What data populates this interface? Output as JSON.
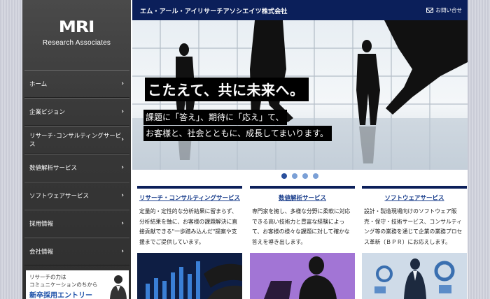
{
  "header": {
    "company_name": "エム・アール・アイリサーチアソシエイツ株式会社",
    "contact_label": "お問い合せ"
  },
  "logo": {
    "mark": "MRI",
    "subtitle": "Research Associates"
  },
  "sidebar": {
    "items": [
      {
        "label": "ホーム"
      },
      {
        "label": "企業ビジョン"
      },
      {
        "label": "リサーチ･コンサルティングサービス"
      },
      {
        "label": "数値解析サービス"
      },
      {
        "label": "ソフトウェアサービス"
      },
      {
        "label": "採用情報"
      },
      {
        "label": "会社情報"
      }
    ],
    "arrow": "›",
    "banner": {
      "line1": "リサーチの力は",
      "line2": "コミュニケーションのちから",
      "line3": "新卒採用エントリー"
    }
  },
  "hero": {
    "headline": "こたえて、共に未来へ。",
    "line1": "課題に「答え」、期待に「応え」て、",
    "line2": "お客様と、社会とともに、成長してまいります。",
    "slide_count": 4,
    "active_slide": 0
  },
  "services": [
    {
      "title": "リサーチ・コンサルティングサービス",
      "text": "定量的・定性的な分析結果に留まらず、分析結果を軸に、お客様の課題解決に直接貢献できる\"一歩踏み込んだ\"提案や支援までご提供しています。"
    },
    {
      "title": "数値解析サービス",
      "text": "専門家を擁し、多様な分野に柔軟に対応できる高い技術力と豊富な経験によって、お客様の様々な課題に対して確かな答えを導き出します。"
    },
    {
      "title": "ソフトウェアサービス",
      "text": "設計・製造現場向けのソフトウェア販売・保守・技術サービス、コンサルティング等の業務を通じて企業の業務プロセス革新（ＢＰＲ）にお応えします。"
    }
  ],
  "colors": {
    "header_bg": "#0b1f5a",
    "link_blue": "#1b3f8c",
    "dot_active": "#2a4f9c",
    "dot_inactive": "#7ba0d6"
  }
}
